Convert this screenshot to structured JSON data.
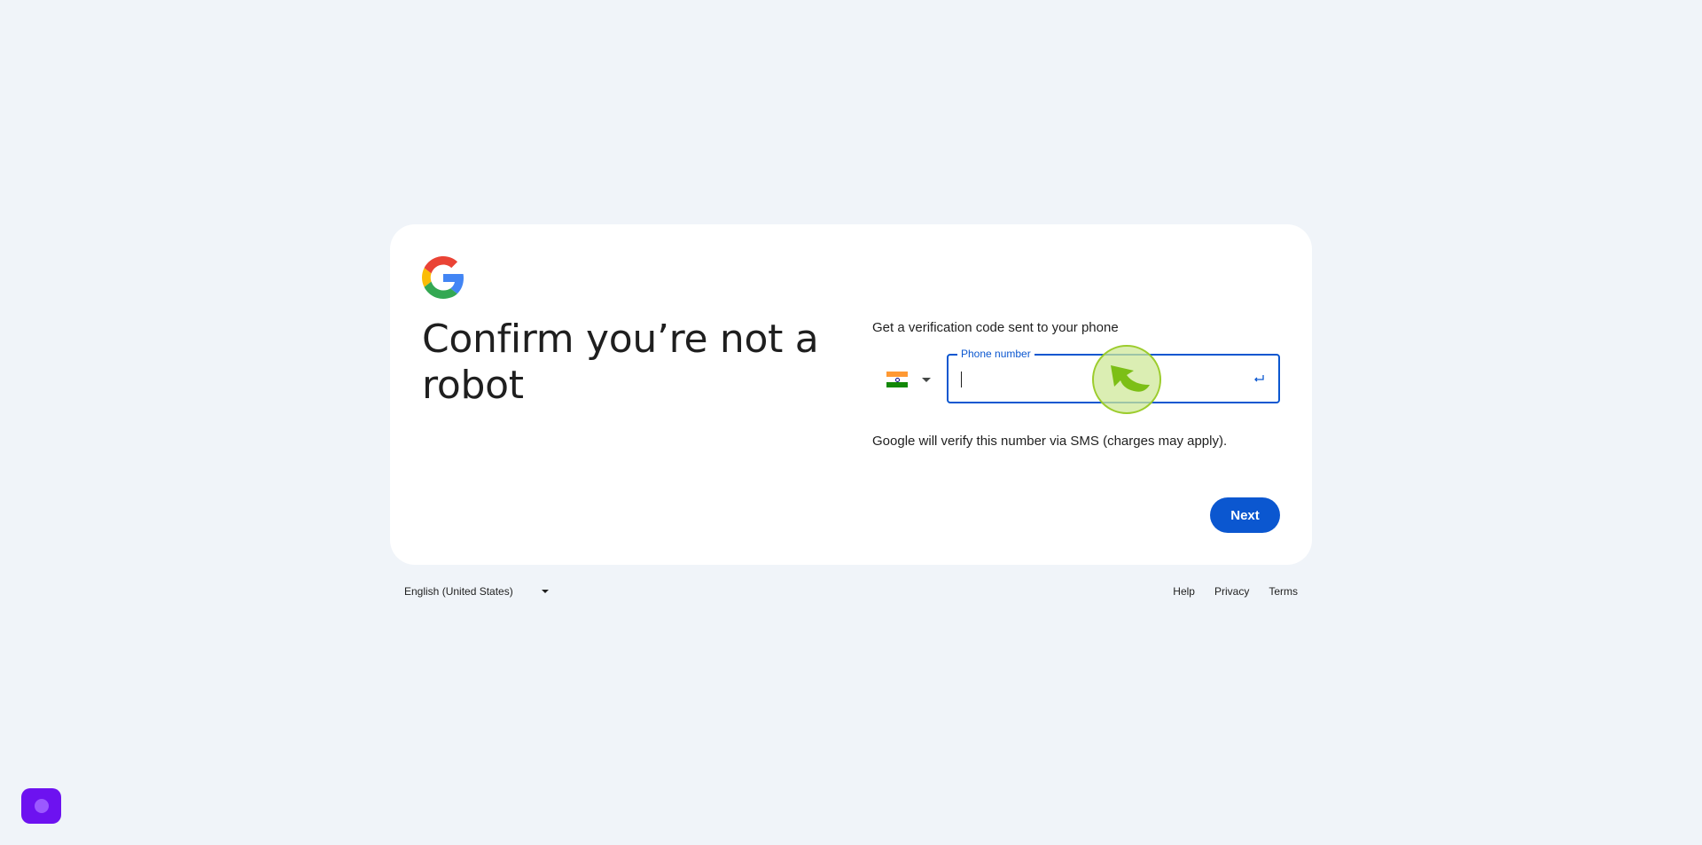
{
  "signin": {
    "title": "Confirm you’re not a robot",
    "prompt": "Get a verification code sent to your phone",
    "country": {
      "flag_icon": "india-flag-icon",
      "expand_icon": "caret-down-icon"
    },
    "phone_field": {
      "label": "Phone number",
      "value": ""
    },
    "hint": "Google will verify this number via SMS (charges may apply).",
    "next_label": "Next"
  },
  "footer": {
    "language": "English (United States)",
    "links": [
      "Help",
      "Privacy",
      "Terms"
    ]
  },
  "colors": {
    "background": "#f0f4f9",
    "accent": "#0b57d0",
    "assistant": "#6d12f0"
  }
}
